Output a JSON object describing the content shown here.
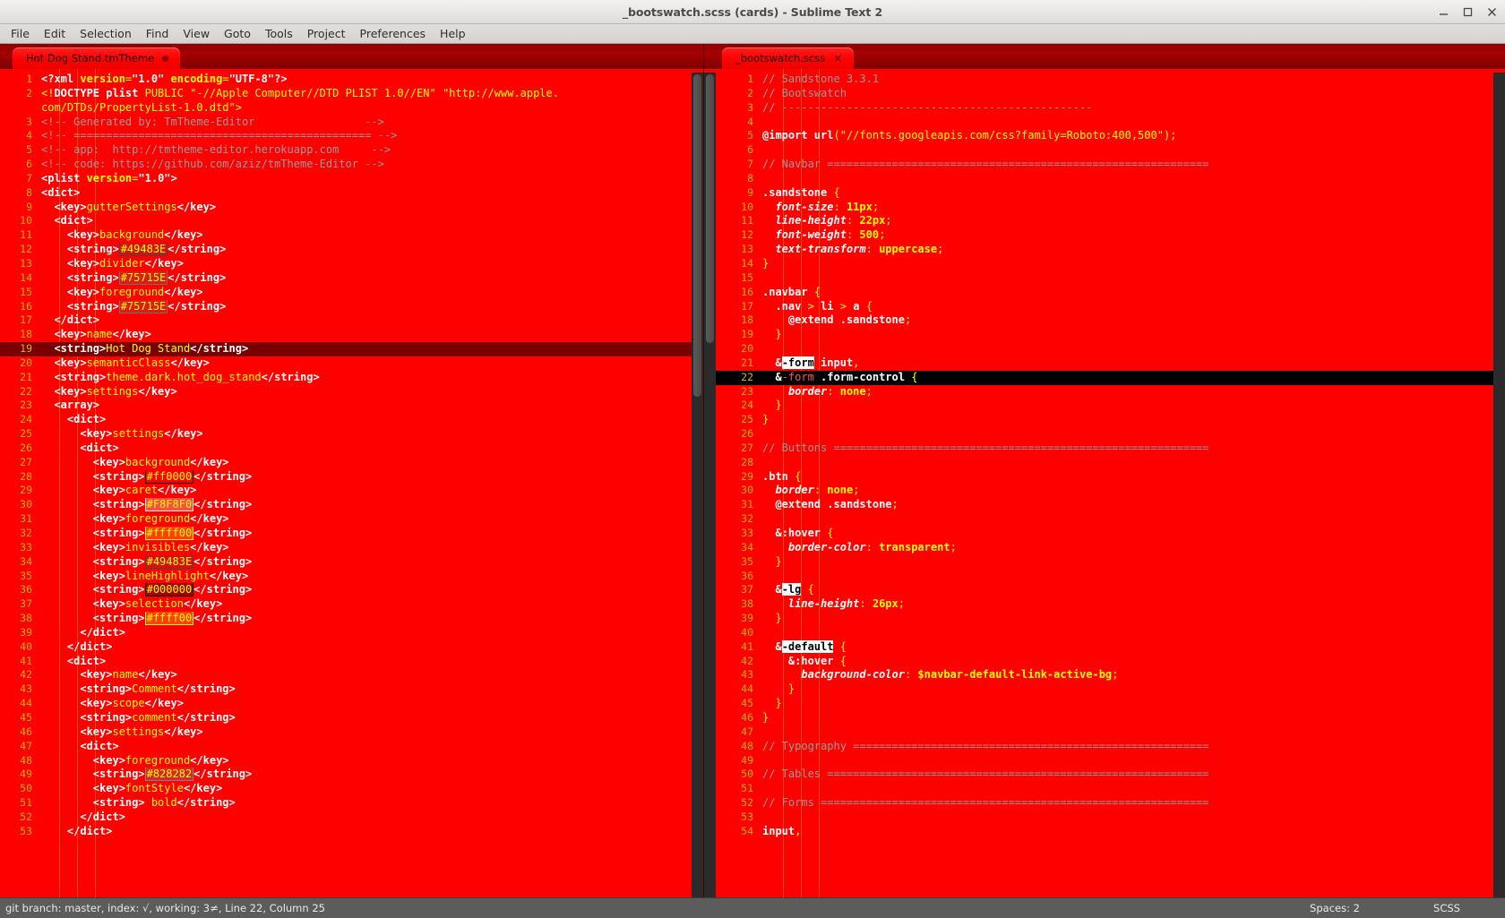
{
  "window": {
    "title": "_bootswatch.scss (cards) - Sublime Text 2",
    "minimize_label": "minimize-window",
    "maximize_label": "maximize-window",
    "close_label": "close-window"
  },
  "menu": {
    "items": [
      {
        "label": "File"
      },
      {
        "label": "Edit"
      },
      {
        "label": "Selection"
      },
      {
        "label": "Find"
      },
      {
        "label": "View"
      },
      {
        "label": "Goto"
      },
      {
        "label": "Tools"
      },
      {
        "label": "Project"
      },
      {
        "label": "Preferences"
      },
      {
        "label": "Help"
      }
    ]
  },
  "tabs": {
    "left": {
      "label": "Hot Dog Stand.tmTheme",
      "dirty": true
    },
    "right": {
      "label": "_bootswatch.scss",
      "close": "×"
    }
  },
  "statusbar": {
    "left": "git branch: master, index: √, working: 3≠, Line 22, Column 25",
    "spaces": "Spaces: 2",
    "syntax": "SCSS"
  },
  "left_editor": {
    "language": "XML / plist",
    "current_line": 19,
    "first_line": 1,
    "lines": [
      {
        "n": 1,
        "html": "<span class=\"tag\">&lt;?xml </span><span class=\"attr\">version</span><span class=\"punc\">=</span><span class=\"tag\">\"1.0\"</span> <span class=\"attr\">encoding</span><span class=\"punc\">=</span><span class=\"tag\">\"UTF-8\"</span><span class=\"tag\">?&gt;</span>"
      },
      {
        "n": 2,
        "html": "<span class=\"tagname\">&lt;!</span><span class=\"tag\">DOCTYPE plist </span><span class=\"str\">PUBLIC \"-//Apple Computer//DTD PLIST 1.0//EN\" \"http://www.apple.</span>"
      },
      {
        "n": null,
        "html": "<span class=\"str\">com/DTDs/PropertyList-1.0.dtd\"</span><span class=\"tagname\">&gt;</span>"
      },
      {
        "n": 3,
        "html": "<span class=\"cmt\">&lt;!-- Generated by: TmTheme-Editor                 --&gt;</span>"
      },
      {
        "n": 4,
        "html": "<span class=\"cmt\">&lt;!-- ============================================== --&gt;</span>"
      },
      {
        "n": 5,
        "html": "<span class=\"cmt\">&lt;!-- app:  http://tmtheme-editor.herokuapp.com     --&gt;</span>"
      },
      {
        "n": 6,
        "html": "<span class=\"cmt\">&lt;!-- code: https://github.com/aziz/tmTheme-Editor --&gt;</span>"
      },
      {
        "n": 7,
        "html": "<span class=\"tag\">&lt;plist </span><span class=\"attr\">version</span><span class=\"punc\">=</span><span class=\"tag\">\"1.0\"</span><span class=\"tag\">&gt;</span>"
      },
      {
        "n": 8,
        "html": "<span class=\"tag\">&lt;dict&gt;</span>"
      },
      {
        "n": 9,
        "html": "  <span class=\"tag\">&lt;key&gt;</span><span class=\"txt\">gutterSettings</span><span class=\"tag\">&lt;/key&gt;</span>"
      },
      {
        "n": 10,
        "html": "  <span class=\"tag\">&lt;dict&gt;</span>"
      },
      {
        "n": 11,
        "html": "    <span class=\"tag\">&lt;key&gt;</span><span class=\"txt\">background</span><span class=\"tag\">&lt;/key&gt;</span>"
      },
      {
        "n": 12,
        "html": "    <span class=\"tag\">&lt;string&gt;</span><span class=\"txt swatch\" style=\"border-color:#49483E;background:rgba(73,72,62,0.25)\">#49483E</span><span class=\"tag\">&lt;/string&gt;</span>"
      },
      {
        "n": 13,
        "html": "    <span class=\"tag\">&lt;key&gt;</span><span class=\"txt\">divider</span><span class=\"tag\">&lt;/key&gt;</span>"
      },
      {
        "n": 14,
        "html": "    <span class=\"tag\">&lt;string&gt;</span><span class=\"txt swatch\" style=\"border-color:#75715E;background:rgba(117,113,94,0.25)\">#75715E</span><span class=\"tag\">&lt;/string&gt;</span>"
      },
      {
        "n": 15,
        "html": "    <span class=\"tag\">&lt;key&gt;</span><span class=\"txt\">foreground</span><span class=\"tag\">&lt;/key&gt;</span>"
      },
      {
        "n": 16,
        "html": "    <span class=\"tag\">&lt;string&gt;</span><span class=\"txt swatch\" style=\"border-color:#75715E;background:rgba(117,113,94,0.25)\">#75715E</span><span class=\"tag\">&lt;/string&gt;</span>"
      },
      {
        "n": 17,
        "html": "  <span class=\"tag\">&lt;/dict&gt;</span>"
      },
      {
        "n": 18,
        "html": "  <span class=\"tag\">&lt;key&gt;</span><span class=\"txt\">name</span><span class=\"tag\">&lt;/key&gt;</span>"
      },
      {
        "n": 19,
        "html": "  <span class=\"tag\">&lt;string&gt;</span><span class=\"txt\">Hot Dog Stand</span><span class=\"tag\">&lt;/string&gt;</span>",
        "hl": "dark"
      },
      {
        "n": 20,
        "html": "  <span class=\"tag\">&lt;key&gt;</span><span class=\"txt\">semanticClass</span><span class=\"tag\">&lt;/key&gt;</span>"
      },
      {
        "n": 21,
        "html": "  <span class=\"tag\">&lt;string&gt;</span><span class=\"txt\">theme.dark.hot_dog_stand</span><span class=\"tag\">&lt;/string&gt;</span>"
      },
      {
        "n": 22,
        "html": "  <span class=\"tag\">&lt;key&gt;</span><span class=\"txt\">settings</span><span class=\"tag\">&lt;/key&gt;</span>"
      },
      {
        "n": 23,
        "html": "  <span class=\"tag\">&lt;array&gt;</span>"
      },
      {
        "n": 24,
        "html": "    <span class=\"tag\">&lt;dict&gt;</span>"
      },
      {
        "n": 25,
        "html": "      <span class=\"tag\">&lt;key&gt;</span><span class=\"txt\">settings</span><span class=\"tag\">&lt;/key&gt;</span>"
      },
      {
        "n": 26,
        "html": "      <span class=\"tag\">&lt;dict&gt;</span>"
      },
      {
        "n": 27,
        "html": "        <span class=\"tag\">&lt;key&gt;</span><span class=\"txt\">background</span><span class=\"tag\">&lt;/key&gt;</span>"
      },
      {
        "n": 28,
        "html": "        <span class=\"tag\">&lt;string&gt;</span><span class=\"txt swatch\" style=\"border-color:#000;background:rgba(255,0,0,0.2)\">#ff0000</span><span class=\"tag\">&lt;/string&gt;</span>"
      },
      {
        "n": 29,
        "html": "        <span class=\"tag\">&lt;key&gt;</span><span class=\"txt\">caret</span><span class=\"tag\">&lt;/key&gt;</span>"
      },
      {
        "n": 30,
        "html": "        <span class=\"tag\">&lt;string&gt;</span><span class=\"txt swatch\" style=\"border-color:#F8F8F0;background:rgba(248,248,240,0.3)\">#F8F8F0</span><span class=\"tag\">&lt;/string&gt;</span>"
      },
      {
        "n": 31,
        "html": "        <span class=\"tag\">&lt;key&gt;</span><span class=\"txt\">foreground</span><span class=\"tag\">&lt;/key&gt;</span>"
      },
      {
        "n": 32,
        "html": "        <span class=\"tag\">&lt;string&gt;</span><span class=\"txt swatch\" style=\"border-color:#ffff00;background:rgba(255,255,0,0.25)\">#ffff00</span><span class=\"tag\">&lt;/string&gt;</span>"
      },
      {
        "n": 33,
        "html": "        <span class=\"tag\">&lt;key&gt;</span><span class=\"txt\">invisibles</span><span class=\"tag\">&lt;/key&gt;</span>"
      },
      {
        "n": 34,
        "html": "        <span class=\"tag\">&lt;string&gt;</span><span class=\"txt swatch\" style=\"border-color:#49483E;background:rgba(73,72,62,0.25)\">#49483E</span><span class=\"tag\">&lt;/string&gt;</span>"
      },
      {
        "n": 35,
        "html": "        <span class=\"tag\">&lt;key&gt;</span><span class=\"txt\">lineHighlight</span><span class=\"tag\">&lt;/key&gt;</span>"
      },
      {
        "n": 36,
        "html": "        <span class=\"tag\">&lt;string&gt;</span><span class=\"txt swatch\" style=\"border-color:#000000;background:rgba(0,0,0,0.35)\">#000000</span><span class=\"tag\">&lt;/string&gt;</span>"
      },
      {
        "n": 37,
        "html": "        <span class=\"tag\">&lt;key&gt;</span><span class=\"txt\">selection</span><span class=\"tag\">&lt;/key&gt;</span>"
      },
      {
        "n": 38,
        "html": "        <span class=\"tag\">&lt;string&gt;</span><span class=\"txt swatch\" style=\"border-color:#ffff00;background:rgba(255,255,0,0.25)\">#ffff00</span><span class=\"tag\">&lt;/string&gt;</span>"
      },
      {
        "n": 39,
        "html": "      <span class=\"tag\">&lt;/dict&gt;</span>"
      },
      {
        "n": 40,
        "html": "    <span class=\"tag\">&lt;/dict&gt;</span>"
      },
      {
        "n": 41,
        "html": "    <span class=\"tag\">&lt;dict&gt;</span>"
      },
      {
        "n": 42,
        "html": "      <span class=\"tag\">&lt;key&gt;</span><span class=\"txt\">name</span><span class=\"tag\">&lt;/key&gt;</span>"
      },
      {
        "n": 43,
        "html": "      <span class=\"tag\">&lt;string&gt;</span><span class=\"txt\">Comment</span><span class=\"tag\">&lt;/string&gt;</span>"
      },
      {
        "n": 44,
        "html": "      <span class=\"tag\">&lt;key&gt;</span><span class=\"txt\">scope</span><span class=\"tag\">&lt;/key&gt;</span>"
      },
      {
        "n": 45,
        "html": "      <span class=\"tag\">&lt;string&gt;</span><span class=\"txt\">comment</span><span class=\"tag\">&lt;/string&gt;</span>"
      },
      {
        "n": 46,
        "html": "      <span class=\"tag\">&lt;key&gt;</span><span class=\"txt\">settings</span><span class=\"tag\">&lt;/key&gt;</span>"
      },
      {
        "n": 47,
        "html": "      <span class=\"tag\">&lt;dict&gt;</span>"
      },
      {
        "n": 48,
        "html": "        <span class=\"tag\">&lt;key&gt;</span><span class=\"txt\">foreground</span><span class=\"tag\">&lt;/key&gt;</span>"
      },
      {
        "n": 49,
        "html": "        <span class=\"tag\">&lt;string&gt;</span><span class=\"txt swatch\" style=\"border-color:#828282;background:rgba(130,130,130,0.3)\">#828282</span><span class=\"tag\">&lt;/string&gt;</span>"
      },
      {
        "n": 50,
        "html": "        <span class=\"tag\">&lt;key&gt;</span><span class=\"txt\">fontStyle</span><span class=\"tag\">&lt;/key&gt;</span>"
      },
      {
        "n": 51,
        "html": "        <span class=\"tag\">&lt;string&gt;</span><span class=\"txt\"> bold</span><span class=\"tag\">&lt;/string&gt;</span>"
      },
      {
        "n": 52,
        "html": "      <span class=\"tag\">&lt;/dict&gt;</span>"
      },
      {
        "n": 53,
        "html": "    <span class=\"tag\">&lt;/dict&gt;</span>"
      }
    ]
  },
  "right_editor": {
    "language": "SCSS",
    "current_line": 22,
    "first_line": 1,
    "lines": [
      {
        "n": 1,
        "html": "<span class=\"cmt\">// Sandstone 3.3.1</span>"
      },
      {
        "n": 2,
        "html": "<span class=\"cmt\">// Bootswatch</span>"
      },
      {
        "n": 3,
        "html": "<span class=\"cmt\">// ------------------------------------------------</span>"
      },
      {
        "n": 4,
        "html": ""
      },
      {
        "n": 5,
        "html": "<span class=\"kw\">@import </span><span class=\"kw\">url</span><span class=\"punc\">(</span><span class=\"str\">\"//fonts.googleapis.com/css?family=Roboto:400,500\"</span><span class=\"punc\">);</span>"
      },
      {
        "n": 6,
        "html": ""
      },
      {
        "n": 7,
        "html": "<span class=\"cmt\">// Navbar ===========================================================</span>"
      },
      {
        "n": 8,
        "html": ""
      },
      {
        "n": 9,
        "html": "<span class=\"kw\">.sandstone</span> <span class=\"brace\">{</span>"
      },
      {
        "n": 10,
        "html": "  <span class=\"prop\">font-size</span><span class=\"punc\">:</span> <span class=\"val\">11px</span><span class=\"punc\">;</span>"
      },
      {
        "n": 11,
        "html": "  <span class=\"prop\">line-height</span><span class=\"punc\">:</span> <span class=\"val\">22px</span><span class=\"punc\">;</span>"
      },
      {
        "n": 12,
        "html": "  <span class=\"prop\">font-weight</span><span class=\"punc\">:</span> <span class=\"val\">500</span><span class=\"punc\">;</span>"
      },
      {
        "n": 13,
        "html": "  <span class=\"prop\">text-transform</span><span class=\"punc\">:</span> <span class=\"val\">uppercase</span><span class=\"punc\">;</span>"
      },
      {
        "n": 14,
        "html": "<span class=\"brace\">}</span>"
      },
      {
        "n": 15,
        "html": ""
      },
      {
        "n": 16,
        "html": "<span class=\"kw\">.navbar</span> <span class=\"brace\">{</span>"
      },
      {
        "n": 17,
        "html": "  <span class=\"kw\">.nav</span> <span class=\"punc\">&gt;</span> <span class=\"kw\">li</span> <span class=\"punc\">&gt;</span> <span class=\"kw\">a</span> <span class=\"brace\">{</span>"
      },
      {
        "n": 18,
        "html": "    <span class=\"kw\">@extend</span> <span class=\"kw\">.sandstone</span><span class=\"punc\">;</span>"
      },
      {
        "n": 19,
        "html": "  <span class=\"brace\">}</span>"
      },
      {
        "n": 20,
        "html": ""
      },
      {
        "n": 21,
        "html": "  <span class=\"amp\">&amp;</span><span class=\"match\">-form</span> <span class=\"kw\">input</span><span class=\"punc\">,</span>"
      },
      {
        "n": 22,
        "html": "  <span class=\"amp\">&amp;</span><span class=\"sel\">-form</span> <span class=\"kw\">.form-control</span> <span class=\"brace\">{</span>",
        "hl": "black"
      },
      {
        "n": 23,
        "html": "    <span class=\"prop\">border</span><span class=\"punc\">:</span> <span class=\"val\">none</span><span class=\"punc\">;</span>"
      },
      {
        "n": 24,
        "html": "  <span class=\"brace\">}</span>"
      },
      {
        "n": 25,
        "html": "<span class=\"brace\">}</span>"
      },
      {
        "n": 26,
        "html": ""
      },
      {
        "n": 27,
        "html": "<span class=\"cmt\">// Buttons ==========================================================</span>"
      },
      {
        "n": 28,
        "html": ""
      },
      {
        "n": 29,
        "html": "<span class=\"kw\">.btn</span> <span class=\"brace\">{</span>"
      },
      {
        "n": 30,
        "html": "  <span class=\"prop\">border</span><span class=\"punc\">:</span> <span class=\"val\">none</span><span class=\"punc\">;</span>"
      },
      {
        "n": 31,
        "html": "  <span class=\"kw\">@extend</span> <span class=\"kw\">.sandstone</span><span class=\"punc\">;</span>"
      },
      {
        "n": 32,
        "html": ""
      },
      {
        "n": 33,
        "html": "  <span class=\"amp\">&amp;</span><span class=\"kw\">:hover</span> <span class=\"brace\">{</span>"
      },
      {
        "n": 34,
        "html": "    <span class=\"prop\">border-color</span><span class=\"punc\">:</span> <span class=\"val\">transparent</span><span class=\"punc\">;</span>"
      },
      {
        "n": 35,
        "html": "  <span class=\"brace\">}</span>"
      },
      {
        "n": 36,
        "html": ""
      },
      {
        "n": 37,
        "html": "  <span class=\"amp\">&amp;</span><span class=\"match\">-lg</span> <span class=\"brace\">{</span>"
      },
      {
        "n": 38,
        "html": "    <span class=\"prop\">line-height</span><span class=\"punc\">:</span> <span class=\"val\">26px</span><span class=\"punc\">;</span>"
      },
      {
        "n": 39,
        "html": "  <span class=\"brace\">}</span>"
      },
      {
        "n": 40,
        "html": ""
      },
      {
        "n": 41,
        "html": "  <span class=\"amp\">&amp;</span><span class=\"match\">-default</span> <span class=\"brace\">{</span>"
      },
      {
        "n": 42,
        "html": "    <span class=\"amp\">&amp;</span><span class=\"kw\">:hover</span> <span class=\"brace\">{</span>"
      },
      {
        "n": 43,
        "html": "      <span class=\"prop\">background-color</span><span class=\"punc\">:</span> <span class=\"var\">$navbar-default-link-active-bg</span><span class=\"punc\">;</span>"
      },
      {
        "n": 44,
        "html": "    <span class=\"brace\">}</span>"
      },
      {
        "n": 45,
        "html": "  <span class=\"brace\">}</span>"
      },
      {
        "n": 46,
        "html": "<span class=\"brace\">}</span>"
      },
      {
        "n": 47,
        "html": ""
      },
      {
        "n": 48,
        "html": "<span class=\"cmt\">// Typography =======================================================</span>"
      },
      {
        "n": 49,
        "html": ""
      },
      {
        "n": 50,
        "html": "<span class=\"cmt\">// Tables ===========================================================</span>"
      },
      {
        "n": 51,
        "html": ""
      },
      {
        "n": 52,
        "html": "<span class=\"cmt\">// Forms ============================================================</span>"
      },
      {
        "n": 53,
        "html": ""
      },
      {
        "n": 54,
        "html": "<span class=\"kw\">input</span><span class=\"punc\">,</span>"
      }
    ]
  },
  "theme_colors": {
    "editor_background": "#ff0000",
    "editor_foreground": "#ffff00",
    "comment": "#9a9a9a",
    "current_line_left": "#7a0000",
    "current_line_right": "#000000",
    "gutter_number": "#d7b200",
    "tab_active": "#ff0000",
    "tabbar_background": "#8f0000",
    "statusbar_background": "#5c5c5c",
    "scrollbar_track": "#2b2b2b"
  }
}
